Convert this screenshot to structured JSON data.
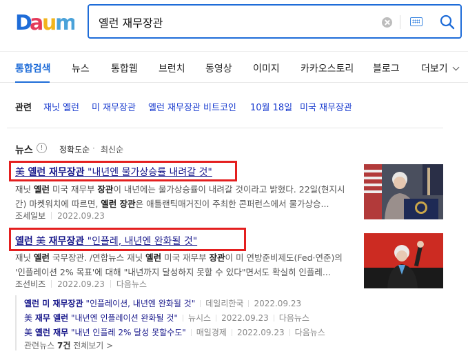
{
  "logo": {
    "text": "Daum",
    "colors": [
      "#1e6cd8",
      "#e43b5a",
      "#f2b51d",
      "#4aa2d9"
    ]
  },
  "search": {
    "value": "옐런 재무장관"
  },
  "tabs": [
    {
      "label": "통합검색",
      "active": true
    },
    {
      "label": "뉴스"
    },
    {
      "label": "통합웹"
    },
    {
      "label": "브런치"
    },
    {
      "label": "동영상"
    },
    {
      "label": "이미지"
    },
    {
      "label": "카카오스토리"
    },
    {
      "label": "블로그"
    },
    {
      "label": "더보기"
    }
  ],
  "related": {
    "title": "관련",
    "items": [
      "재닛 옐런",
      "미 재무장관",
      "옐런 재무장관 비트코인",
      "10월 18일",
      "미국 재무장관"
    ]
  },
  "news": {
    "title": "뉴스",
    "sort_accuracy": "정확도순",
    "sort_dot": "·",
    "sort_latest": "최신순",
    "articles": [
      {
        "title_pre": "美 ",
        "title_b1": "옐런 재무장관",
        "title_post": " \"내년엔 물가상승률 내려갈 것\"",
        "snippet_1": "재닛 ",
        "snippet_b1": "옐런",
        "snippet_2": " 미국 재무부 ",
        "snippet_b2": "장관",
        "snippet_3": "이 내년에는 물가상승률이 내려갈 것이라고 밝혔다. 22일(현지시간) 마켓워치에 따르면, ",
        "snippet_b3": "옐런 장관",
        "snippet_4": "은 애틀랜틱매거진이 주최한 콘퍼런스에서 물가상승...",
        "source": "조세일보",
        "date": "2022.09.23"
      },
      {
        "title_b1": "옐런",
        "title_mid": " 美 ",
        "title_b2": "재무장관",
        "title_post": " \"인플레, 내년엔 완화될 것\"",
        "snippet_1": "재닛 ",
        "snippet_b1": "옐런",
        "snippet_2": " 국무장관. /연합뉴스 재닛 ",
        "snippet_b2": "옐런",
        "snippet_3": " 미국 재무부 ",
        "snippet_b3": "장관",
        "snippet_4": "이 미 연방준비제도(Fed·연준)의 '인플레이션 2% 목표'에 대해 \"내년까지 달성하지 못할 수 있다\"면서도 확실히 인플레...",
        "source": "조선비즈",
        "date": "2022.09.23",
        "via": "다음뉴스"
      }
    ],
    "sub_articles": [
      {
        "t_b": "옐런 미 재무장관",
        "t_rest": " \"인플레이션, 내년엔 완화될 것\"",
        "source": "데일리한국",
        "date": "2022.09.23"
      },
      {
        "t_pre": "美 ",
        "t_b": "재무 옐런",
        "t_rest": " \"내년엔 인플레이션 완화될 것\"",
        "source": "뉴시스",
        "date": "2022.09.23",
        "via": "다음뉴스"
      },
      {
        "t_pre": "美 ",
        "t_b": "옐런 재무",
        "t_rest": " \"내년 인플레 2% 달성 못할수도\"",
        "source": "매일경제",
        "date": "2022.09.23",
        "via": "다음뉴스"
      }
    ],
    "more_pre": "관련뉴스 ",
    "more_count": "7건",
    "more_post": " 전체보기 >"
  }
}
